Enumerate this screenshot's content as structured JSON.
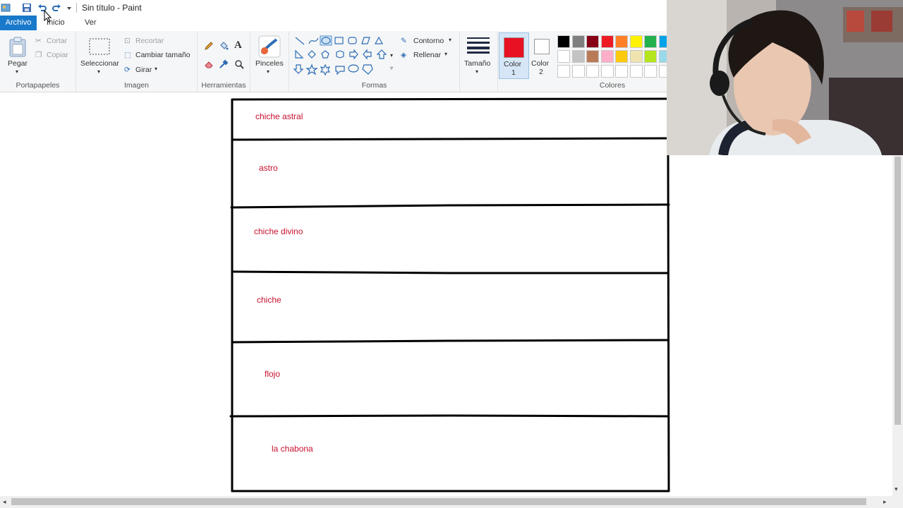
{
  "window": {
    "title": "Sin título - Paint"
  },
  "tabs": [
    {
      "label": "Archivo"
    },
    {
      "label": "Inicio"
    },
    {
      "label": "Ver"
    }
  ],
  "ribbon": {
    "clipboard": {
      "label": "Portapapeles",
      "paste": "Pegar",
      "cut": "Cortar",
      "copy": "Copiar"
    },
    "image": {
      "label": "Imagen",
      "select": "Seleccionar",
      "crop": "Recortar",
      "resize": "Cambiar tamaño",
      "rotate": "Girar"
    },
    "tools": {
      "label": "Herramientas"
    },
    "brushes": {
      "label": "Pinceles"
    },
    "shapes": {
      "label": "Formas",
      "outline": "Contorno",
      "fill": "Rellenar"
    },
    "size": {
      "label": "Tamaño"
    },
    "color1": {
      "label": "Color",
      "num": "1",
      "value": "#e81123"
    },
    "color2": {
      "label": "Color",
      "num": "2",
      "value": "#ffffff"
    },
    "colors": {
      "label": "Colores"
    }
  },
  "palette": {
    "row1": [
      "#000000",
      "#7f7f7f",
      "#880015",
      "#ed1c24",
      "#ff7f27",
      "#fff200",
      "#22b14c",
      "#00a2e8"
    ],
    "row2": [
      "#ffffff",
      "#c3c3c3",
      "#b97a57",
      "#ffaec9",
      "#ffc90e",
      "#efe4b0",
      "#b5e61d",
      "#99d9ea"
    ]
  },
  "canvas": {
    "rows": [
      {
        "text": "chiche astral"
      },
      {
        "text": "astro"
      },
      {
        "text": "chiche divino"
      },
      {
        "text": "chiche"
      },
      {
        "text": "flojo"
      },
      {
        "text": "la chabona"
      }
    ]
  }
}
